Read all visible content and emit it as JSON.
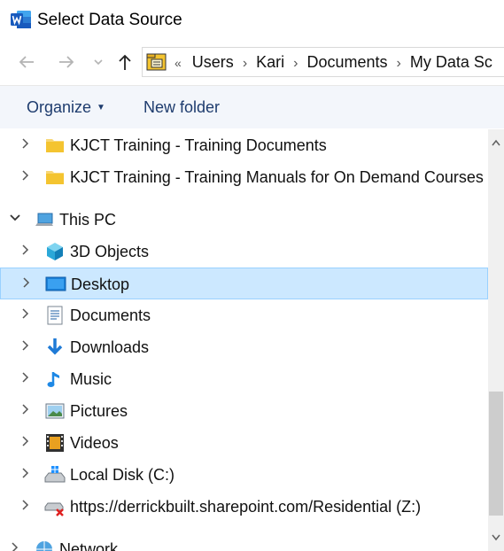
{
  "window": {
    "title": "Select Data Source",
    "app_icon": "word-icon"
  },
  "navigation": {
    "back_icon": "arrow-left-icon",
    "forward_icon": "arrow-right-icon",
    "recent_icon": "chevron-down-icon",
    "up_icon": "arrow-up-icon"
  },
  "address": {
    "overflow_glyph": "«",
    "breadcrumbs": [
      "Users",
      "Kari",
      "Documents",
      "My Data Sc"
    ]
  },
  "toolbar": {
    "organize_label": "Organize",
    "new_folder_label": "New folder"
  },
  "tree": {
    "items": [
      {
        "label": "KJCT Training - Training Documents",
        "icon": "folder-icon"
      },
      {
        "label": "KJCT Training - Training Manuals for On Demand Courses",
        "icon": "folder-icon"
      },
      {
        "label": "This PC",
        "icon": "computer-icon",
        "expanded": true
      },
      {
        "label": "3D Objects",
        "icon": "3d-objects-icon"
      },
      {
        "label": "Desktop",
        "icon": "desktop-icon",
        "selected": true
      },
      {
        "label": "Documents",
        "icon": "documents-icon"
      },
      {
        "label": "Downloads",
        "icon": "downloads-icon"
      },
      {
        "label": "Music",
        "icon": "music-icon"
      },
      {
        "label": "Pictures",
        "icon": "pictures-icon"
      },
      {
        "label": "Videos",
        "icon": "videos-icon"
      },
      {
        "label": "Local Disk (C:)",
        "icon": "local-disk-icon"
      },
      {
        "label": "https://derrickbuilt.sharepoint.com/Residential (Z:)",
        "icon": "network-drive-disconnected-icon"
      },
      {
        "label": "Network",
        "icon": "network-icon"
      }
    ]
  },
  "colors": {
    "selection_bg": "#cce8ff",
    "selection_border": "#99d1ff",
    "toolbar_bg": "#f3f6fb",
    "toolbar_text": "#1e3c6e"
  }
}
